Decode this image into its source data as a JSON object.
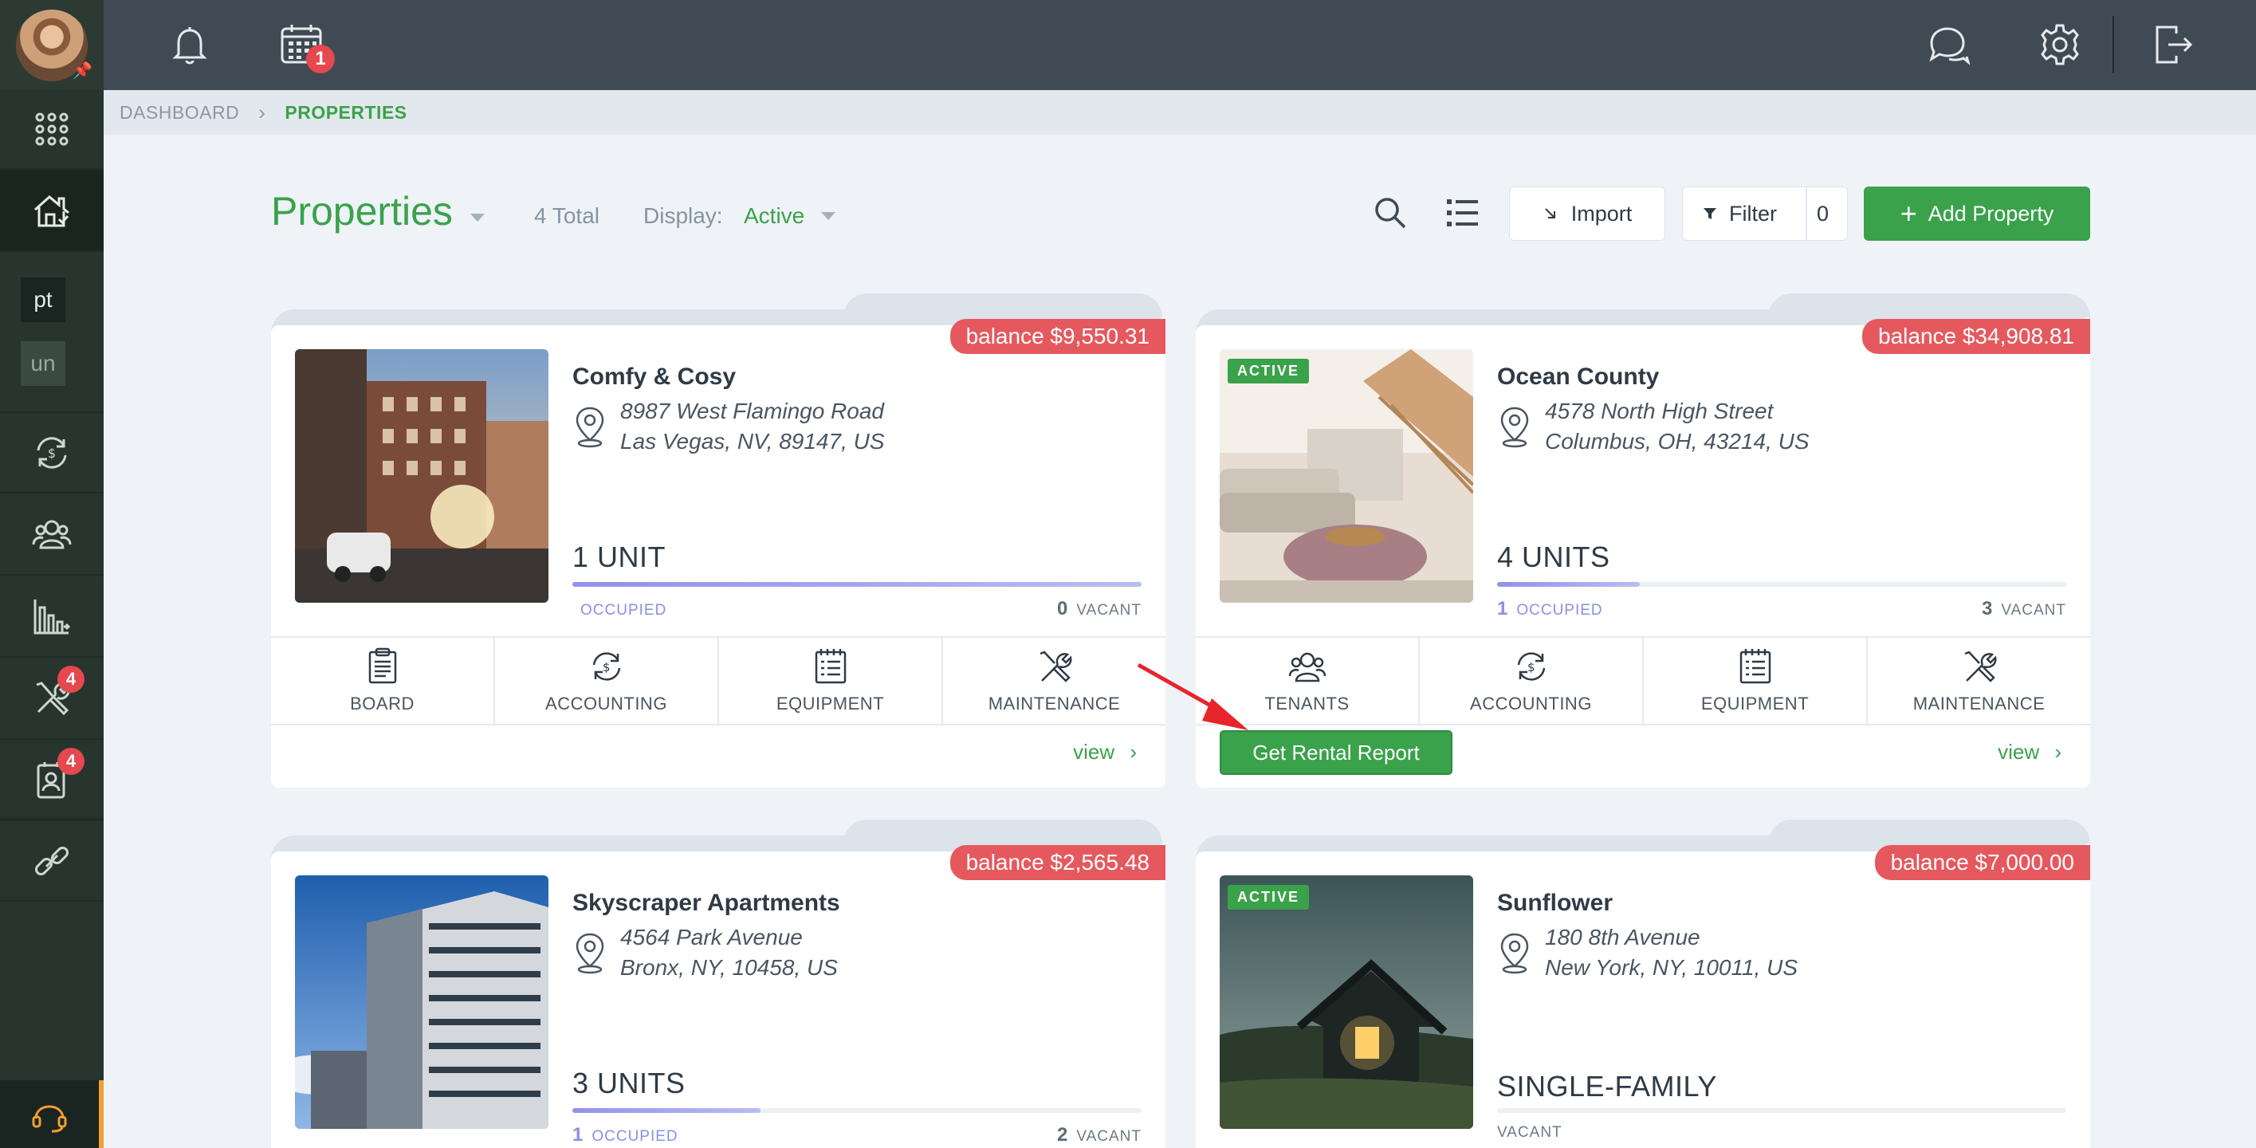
{
  "topbar": {
    "calendar_badge": "1"
  },
  "sidebar": {
    "text_items": [
      "pt",
      "un"
    ],
    "maintenance_badge": "4",
    "contacts_badge": "4"
  },
  "breadcrumb": {
    "root": "DASHBOARD",
    "current": "PROPERTIES"
  },
  "header": {
    "title": "Properties",
    "total": "4 Total",
    "display_label": "Display:",
    "display_value": "Active",
    "import_label": "Import",
    "filter_label": "Filter",
    "filter_count": "0",
    "add_label": "Add Property"
  },
  "properties": [
    {
      "name": "Comfy & Cosy",
      "address1": "8987 West Flamingo Road",
      "address2": "Las Vegas, NV, 89147, US",
      "balance": "balance $9,550.31",
      "units": "1 UNIT",
      "occupied_count": "",
      "occupied_label": "OCCUPIED",
      "occupied_fraction": 1.0,
      "vacant_count": "0",
      "vacant_label": "VACANT",
      "actions": [
        "BOARD",
        "ACCOUNTING",
        "EQUIPMENT",
        "MAINTENANCE"
      ],
      "view_label": "view"
    },
    {
      "name": "Ocean County",
      "active_tag": "ACTIVE",
      "address1": "4578 North High Street",
      "address2": "Columbus, OH, 43214, US",
      "balance": "balance $34,908.81",
      "units": "4 UNITS",
      "occupied_count": "1",
      "occupied_label": "OCCUPIED",
      "occupied_fraction": 0.25,
      "vacant_count": "3",
      "vacant_label": "VACANT",
      "actions": [
        "TENANTS",
        "ACCOUNTING",
        "EQUIPMENT",
        "MAINTENANCE"
      ],
      "view_label": "view",
      "rental_report_label": "Get Rental Report"
    },
    {
      "name": "Skyscraper Apartments",
      "address1": "4564 Park Avenue",
      "address2": "Bronx, NY, 10458, US",
      "balance": "balance $2,565.48",
      "units": "3 UNITS",
      "occupied_count": "1",
      "occupied_label": "OCCUPIED",
      "occupied_fraction": 0.33,
      "vacant_count": "2",
      "vacant_label": "VACANT"
    },
    {
      "name": "Sunflower",
      "active_tag": "ACTIVE",
      "address1": "180 8th Avenue",
      "address2": "New York, NY, 10011, US",
      "balance": "balance $7,000.00",
      "units": "SINGLE-FAMILY",
      "vacant_label": "VACANT"
    }
  ],
  "colors": {
    "accent": "#3aa24a",
    "balance": "#e5595e",
    "topbar": "#3f4a55",
    "sidebar": "#27352e"
  }
}
